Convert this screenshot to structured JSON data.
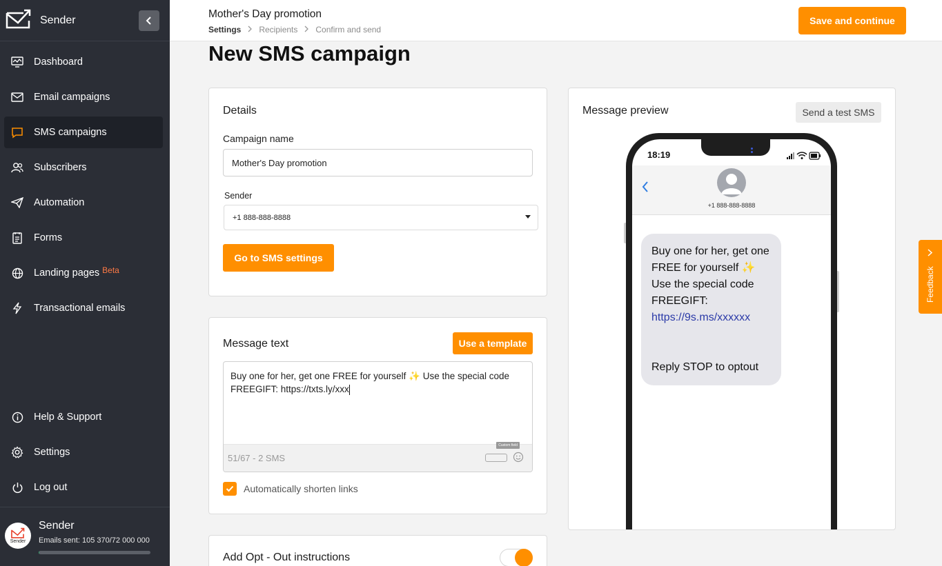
{
  "sidebar": {
    "brand": "Sender",
    "items": [
      {
        "label": "Dashboard",
        "icon": "dashboard-icon"
      },
      {
        "label": "Email campaigns",
        "icon": "envelope-icon"
      },
      {
        "label": "SMS campaigns",
        "icon": "chat-bubble-icon",
        "active": true
      },
      {
        "label": "Subscribers",
        "icon": "users-icon"
      },
      {
        "label": "Automation",
        "icon": "paper-plane-icon"
      },
      {
        "label": "Forms",
        "icon": "form-icon"
      },
      {
        "label": "Landing pages",
        "badge": "Beta",
        "icon": "globe-icon"
      },
      {
        "label": "Transactional emails",
        "icon": "bolt-icon"
      }
    ],
    "bottom_items": [
      {
        "label": "Help & Support",
        "icon": "info-icon"
      },
      {
        "label": "Settings",
        "icon": "gear-icon"
      },
      {
        "label": "Log out",
        "icon": "power-icon"
      }
    ],
    "account": {
      "name": "Sender",
      "avatar_label": "Sender",
      "emails_sent": "Emails sent: 105 370/72 000 000",
      "usage_fraction": 0.0015
    }
  },
  "header": {
    "campaign_name": "Mother's Day promotion",
    "steps": [
      "Settings",
      "Recipients",
      "Confirm and send"
    ],
    "save_button": "Save and continue"
  },
  "page": {
    "title": "New SMS campaign"
  },
  "details": {
    "title": "Details",
    "campaign_name_label": "Campaign name",
    "campaign_name_value": "Mother's Day promotion",
    "sender_label": "Sender",
    "sender_value": "+1 888-888-8888",
    "sms_settings_button": "Go to SMS settings"
  },
  "message": {
    "title": "Message text",
    "template_button": "Use a template",
    "text": "Buy one for her, get one FREE for yourself ✨ Use the special code FREEGIFT: https://txts.ly/xxx",
    "counter": "51/67 - 2 SMS",
    "custom_field_tooltip": "Custom field",
    "shorten_links_label": "Automatically shorten links",
    "shorten_links_checked": true
  },
  "opt_out": {
    "title": "Add Opt - Out instructions",
    "enabled": true
  },
  "preview": {
    "title": "Message preview",
    "test_button": "Send a test SMS",
    "time": "18:19",
    "contact_number": "+1 888-888-8888",
    "bubble_lines": [
      "Buy one for her, get one",
      "FREE for yourself ✨",
      "Use the special code",
      "FREEGIFT:"
    ],
    "bubble_link": "https://9s.ms/xxxxxx",
    "bubble_footer": "Reply STOP to optout"
  },
  "feedback": {
    "label": "Feedback"
  },
  "colors": {
    "accent": "#ff8f00",
    "sidebar": "#2b2e36",
    "link": "#2b3aa8"
  }
}
